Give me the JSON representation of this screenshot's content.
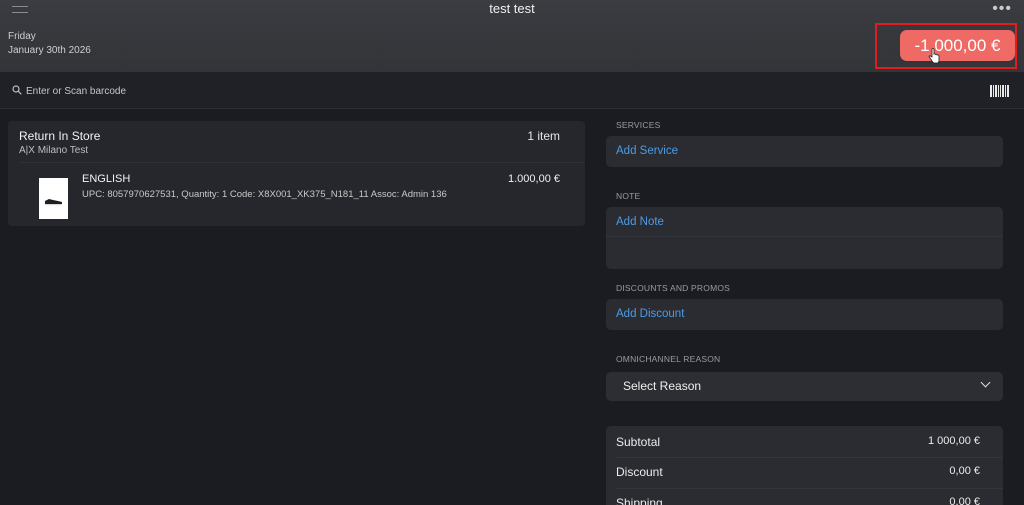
{
  "header": {
    "title": "test test",
    "day": "Friday",
    "date": "January 30th 2026",
    "total_button": "-1 000,00 €"
  },
  "search": {
    "placeholder": "Enter or Scan barcode"
  },
  "cart": {
    "title": "Return In Store",
    "store": "A|X Milano Test",
    "count": "1 item",
    "items": [
      {
        "name": "ENGLISH",
        "details": "UPC: 8057970627531, Quantity: 1 Code: X8X001_XK375_N181_11 Assoc: Admin 136",
        "price": "1.000,00 €"
      }
    ]
  },
  "services": {
    "label": "SERVICES",
    "action": "Add Service"
  },
  "note": {
    "label": "NOTE",
    "action": "Add Note"
  },
  "discounts": {
    "label": "DISCOUNTS AND PROMOS",
    "action": "Add Discount"
  },
  "omnichannel": {
    "label": "OMNICHANNEL REASON",
    "select_value": "Select Reason"
  },
  "summary": {
    "rows": [
      {
        "label": "Subtotal",
        "value": "1 000,00 €"
      },
      {
        "label": "Discount",
        "value": "0,00 €"
      },
      {
        "label": "Shipping",
        "value": "0,00 €"
      }
    ]
  },
  "colors": {
    "accent_link": "#4d9be6",
    "total_button": "#ef6a64",
    "highlight_border": "#e11d1d"
  }
}
